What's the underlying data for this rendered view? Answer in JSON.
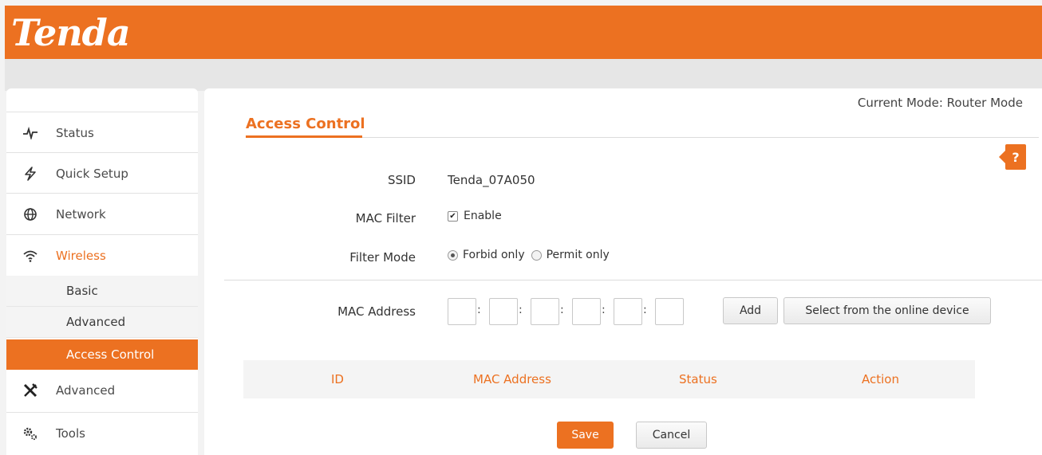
{
  "brand": {
    "logo_text": "Tenda"
  },
  "sidebar": {
    "items": [
      {
        "label": "Status",
        "icon": "pulse-icon"
      },
      {
        "label": "Quick Setup",
        "icon": "lightning-icon"
      },
      {
        "label": "Network",
        "icon": "globe-icon"
      },
      {
        "label": "Wireless",
        "icon": "wifi-icon",
        "active": true
      },
      {
        "label": "Advanced",
        "icon": "tools-icon"
      },
      {
        "label": "Tools",
        "icon": "gears-icon"
      }
    ],
    "wireless_sub": [
      {
        "label": "Basic"
      },
      {
        "label": "Advanced"
      },
      {
        "label": "Access Control",
        "selected": true
      }
    ]
  },
  "main": {
    "current_mode": "Current Mode: Router Mode",
    "title": "Access Control",
    "help_label": "?",
    "form": {
      "ssid_label": "SSID",
      "ssid_value": "Tenda_07A050",
      "mac_filter_label": "MAC Filter",
      "mac_filter_option": "Enable",
      "mac_filter_checked": true,
      "filter_mode_label": "Filter Mode",
      "filter_mode_options": [
        "Forbid only",
        "Permit only"
      ],
      "filter_mode_selected": "Forbid only",
      "mac_address_label": "MAC Address",
      "mac_separator": ":",
      "add_button": "Add",
      "select_button": "Select from the online device"
    },
    "table": {
      "headers": [
        "ID",
        "MAC Address",
        "Status",
        "Action"
      ]
    },
    "buttons": {
      "save": "Save",
      "cancel": "Cancel"
    }
  },
  "colors": {
    "accent": "#ec7121",
    "panel": "#ffffff",
    "background": "#f3f3f3"
  }
}
